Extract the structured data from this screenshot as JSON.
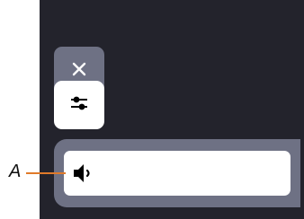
{
  "callout": {
    "label": "A"
  },
  "buttons": {
    "close": {
      "icon": "close-icon"
    },
    "settings": {
      "icon": "sliders-icon"
    },
    "volume": {
      "icon": "speaker-low-volume-icon"
    }
  },
  "colors": {
    "panel_bg": "#23232c",
    "button_gray": "#6e7184",
    "button_white": "#ffffff",
    "callout_line": "#e07a2a"
  }
}
